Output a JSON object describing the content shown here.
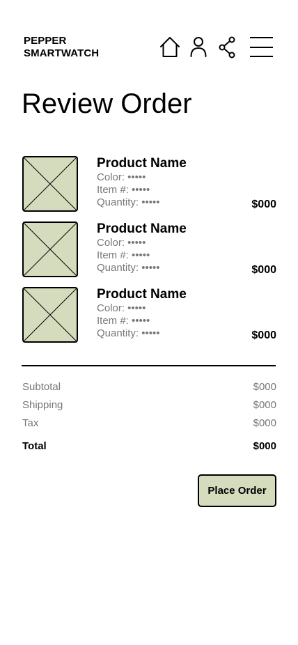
{
  "header": {
    "brand_line1": "PEPPER",
    "brand_line2": "SMARTWATCH",
    "icons": [
      "home-icon",
      "user-icon",
      "share-icon",
      "menu-icon"
    ]
  },
  "page": {
    "title": "Review Order"
  },
  "items": [
    {
      "name": "Product Name",
      "color": "Color: •••••",
      "item_number": "Item #: •••••",
      "quantity": "Quantity: •••••",
      "price": "$000",
      "image_icon": "image-placeholder-icon"
    },
    {
      "name": "Product Name",
      "color": "Color: •••••",
      "item_number": "Item #: •••••",
      "quantity": "Quantity: •••••",
      "price": "$000",
      "image_icon": "image-placeholder-icon"
    },
    {
      "name": "Product Name",
      "color": "Color: •••••",
      "item_number": "Item #: •••••",
      "quantity": "Quantity: •••••",
      "price": "$000",
      "image_icon": "image-placeholder-icon"
    }
  ],
  "summary": {
    "subtotal_label": "Subtotal",
    "subtotal_value": "$000",
    "shipping_label": "Shipping",
    "shipping_value": "$000",
    "tax_label": "Tax",
    "tax_value": "$000",
    "total_label": "Total",
    "total_value": "$000"
  },
  "actions": {
    "place_order_label": "Place Order"
  },
  "colors": {
    "accent": "#d4dcbd",
    "muted_text": "#777777",
    "text": "#000000",
    "background": "#ffffff"
  }
}
